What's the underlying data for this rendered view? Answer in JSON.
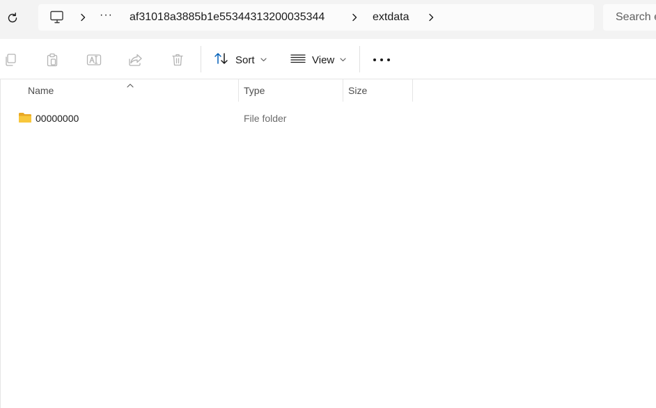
{
  "address_bar": {
    "ellipsis": "···",
    "crumbs": [
      "af31018a3885b1e55344313200035344",
      "extdata"
    ]
  },
  "search": {
    "placeholder": "Search e"
  },
  "toolbar": {
    "sort_label": "Sort",
    "view_label": "View"
  },
  "columns": {
    "name": "Name",
    "type": "Type",
    "size": "Size"
  },
  "files": [
    {
      "name": "00000000",
      "type": "File folder",
      "size": ""
    }
  ],
  "colors": {
    "accent": "#005fb8",
    "folder": "#f8c73c",
    "disabled_icon": "#b3b3b3"
  }
}
